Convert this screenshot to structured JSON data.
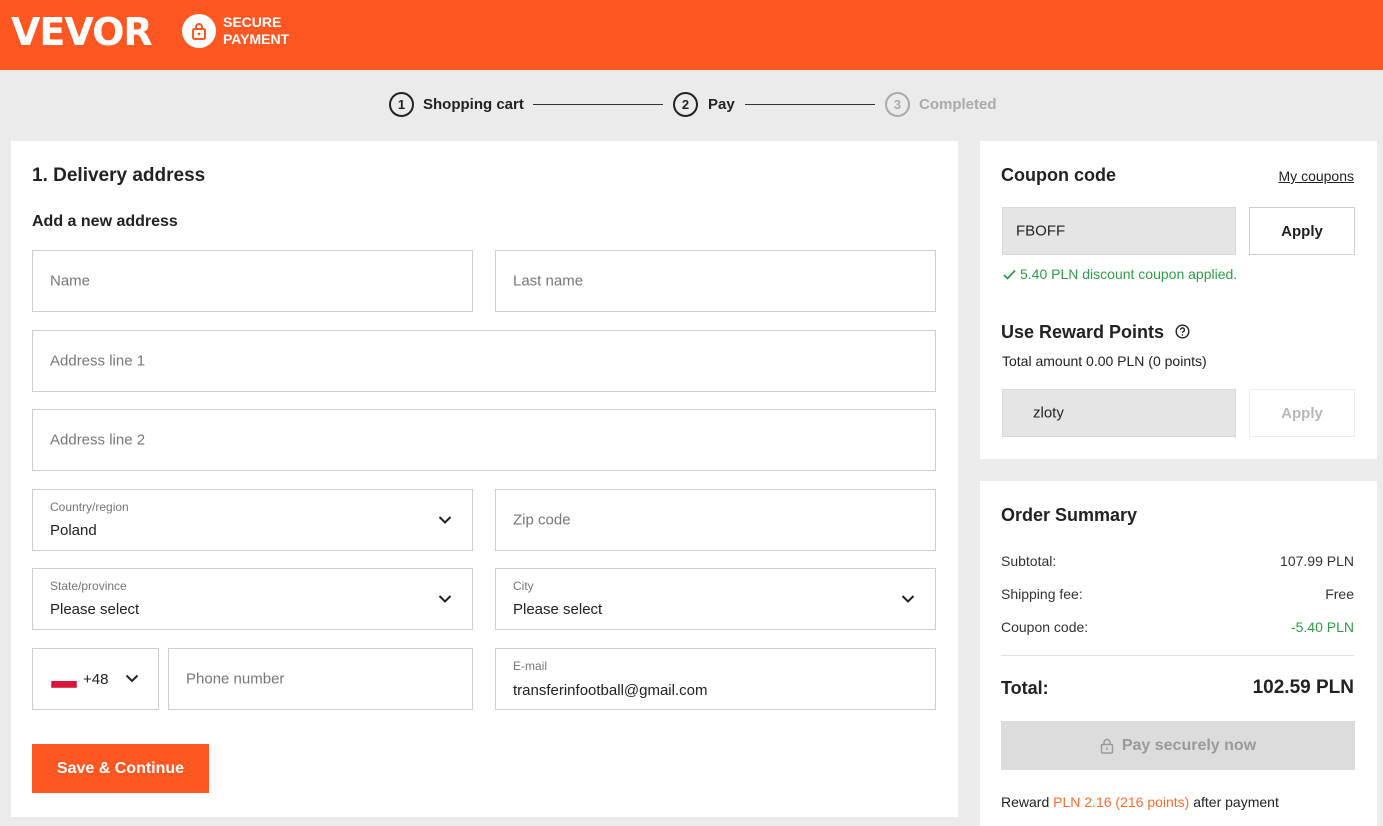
{
  "header": {
    "logo": "VEVOR",
    "secure_line1": "SECURE",
    "secure_line2": "PAYMENT",
    "icons": {
      "secure": "lock-icon"
    },
    "color": "#ff5722"
  },
  "steps": [
    {
      "number": "1",
      "label": "Shopping cart",
      "state": "done"
    },
    {
      "number": "2",
      "label": "Pay",
      "state": "active"
    },
    {
      "number": "3",
      "label": "Completed",
      "state": "pending"
    }
  ],
  "delivery": {
    "section_title": "1. Delivery address",
    "subtitle": "Add a new address",
    "name_placeholder": "Name",
    "last_name_placeholder": "Last name",
    "address1_placeholder": "Address line 1",
    "address2_placeholder": "Address line 2",
    "country_label": "Country/region",
    "country_value": "Poland",
    "zip_placeholder": "Zip code",
    "state_label": "State/province",
    "state_value": "Please select",
    "city_label": "City",
    "city_value": "Please select",
    "phone_code": "+48",
    "phone_placeholder": "Phone number",
    "email_label": "E-mail",
    "email_value": "transferinfootball@gmail.com",
    "save_button": "Save & Continue",
    "icons": {
      "flag": "poland-flag-icon",
      "chevron": "chevron-down-icon"
    }
  },
  "coupon": {
    "title": "Coupon code",
    "my_coupons_link": "My coupons",
    "code_value": "FBOFF",
    "apply_label": "Apply",
    "applied_message": "5.40 PLN discount coupon applied.",
    "icons": {
      "applied": "check-icon"
    }
  },
  "reward": {
    "title": "Use Reward Points",
    "total_text": "Total amount 0.00 PLN (0 points)",
    "input_value": "zloty",
    "apply_label": "Apply",
    "icons": {
      "help": "help-circle-icon"
    }
  },
  "summary": {
    "title": "Order Summary",
    "subtotal_label": "Subtotal:",
    "subtotal_value": "107.99 PLN",
    "shipping_label": "Shipping fee:",
    "shipping_value": "Free",
    "coupon_label": "Coupon code:",
    "coupon_value": "-5.40 PLN",
    "total_label": "Total:",
    "total_value": "102.59 PLN",
    "pay_button": "Pay securely now",
    "reward_prefix": "Reward",
    "reward_amount": "PLN 2.16 (216 points)",
    "reward_suffix": "after payment",
    "icons": {
      "pay": "lock-icon"
    }
  }
}
